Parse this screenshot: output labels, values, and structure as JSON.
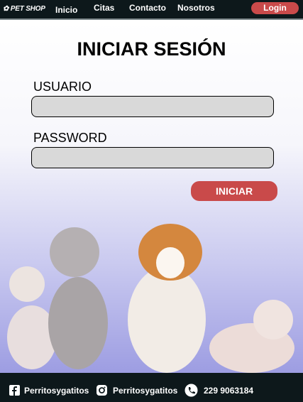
{
  "nav": {
    "logo": "PET SHOP",
    "items": [
      "Inicio",
      "Citas",
      "Contacto",
      "Nosotros"
    ],
    "login": "Login"
  },
  "form": {
    "title": "INICIAR SESIÓN",
    "user_label": "USUARIO",
    "user_value": "",
    "password_label": "PASSWORD",
    "password_value": "",
    "submit": "INICIAR"
  },
  "footer": {
    "facebook": "Perritosygatitos",
    "instagram": "Perritosygatitos",
    "phone": "229 9063184"
  },
  "colors": {
    "nav_bg": "#0d181b",
    "accent": "#c94a4a",
    "input_bg": "#d9d9d9"
  }
}
